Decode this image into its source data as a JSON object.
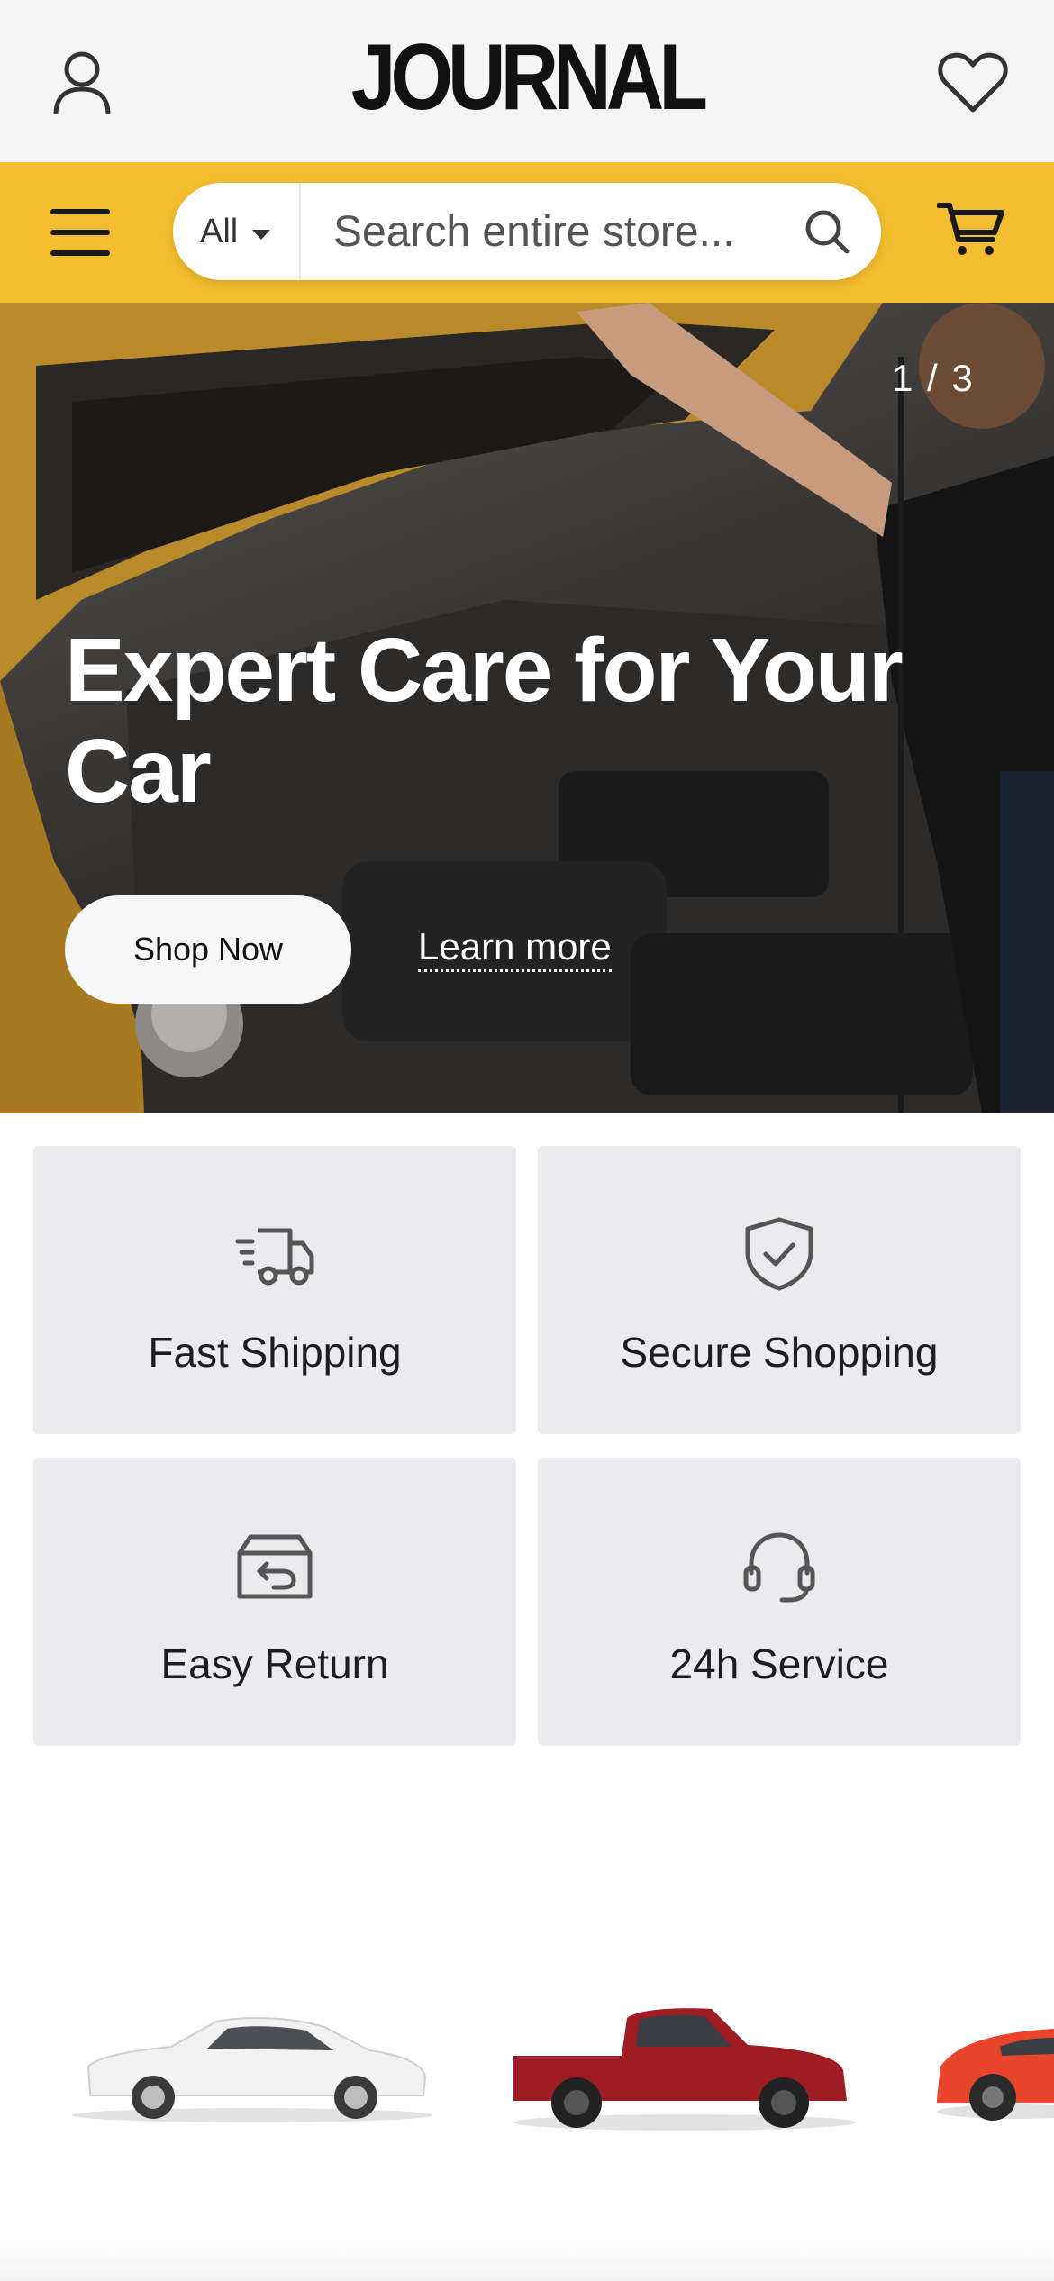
{
  "header": {
    "logo_text": "JOURNAL",
    "account_icon": "user-icon",
    "wishlist_icon": "heart-icon"
  },
  "search": {
    "menu_icon": "hamburger-icon",
    "category": "All",
    "placeholder": "Search entire store...",
    "search_icon": "magnifier-icon",
    "cart_icon": "cart-icon",
    "band_color": "#f2bd2f"
  },
  "hero": {
    "counter": "1 / 3",
    "title": "Expert Care for Your Car",
    "primary_button": "Shop Now",
    "secondary_link": "Learn more"
  },
  "features": [
    {
      "label": "Fast Shipping",
      "icon": "truck-icon"
    },
    {
      "label": "Secure Shopping",
      "icon": "shield-check-icon"
    },
    {
      "label": "Easy Return",
      "icon": "return-box-icon"
    },
    {
      "label": "24h Service",
      "icon": "headset-icon"
    }
  ],
  "vehicles": [
    {
      "icon": "sedan-icon",
      "color": "#f2f2f2"
    },
    {
      "icon": "pickup-truck-icon",
      "color": "#9e1c22"
    },
    {
      "icon": "sports-car-icon",
      "color": "#e8452c"
    }
  ]
}
